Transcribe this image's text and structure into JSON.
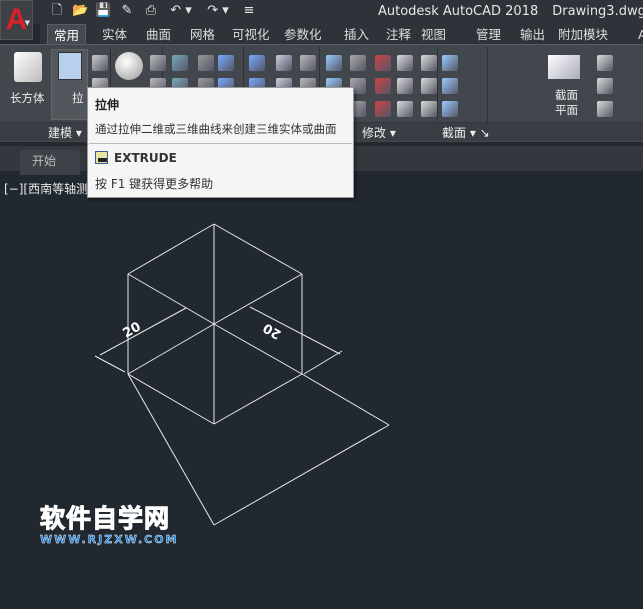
{
  "app": {
    "logo_letter": "A",
    "title": "Autodesk AutoCAD 2018",
    "document": "Drawing3.dwg"
  },
  "quick_access": [
    "new-icon",
    "open-icon",
    "save-icon",
    "saveas-icon",
    "plot-icon",
    "undo-icon",
    "redo-icon",
    "customize-icon"
  ],
  "tabs": [
    {
      "label": "常用",
      "active": true
    },
    {
      "label": "实体"
    },
    {
      "label": "曲面"
    },
    {
      "label": "网格"
    },
    {
      "label": "可视化"
    },
    {
      "label": "参数化"
    },
    {
      "label": "插入"
    },
    {
      "label": "注释"
    },
    {
      "label": "视图"
    },
    {
      "label": "管理"
    },
    {
      "label": "输出"
    },
    {
      "label": "附加模块"
    },
    {
      "label": "A"
    }
  ],
  "ribbon": {
    "box_label": "长方体",
    "extrude_label": "拉",
    "section_plane_label1": "截面",
    "section_plane_label2": "平面",
    "panels": [
      {
        "label": "建模"
      },
      {
        "label": "修改"
      },
      {
        "label": "截面"
      }
    ]
  },
  "tooltip": {
    "title": "拉伸",
    "description": "通过拉伸二维或三维曲线来创建三维实体或曲面",
    "command": "EXTRUDE",
    "help": "按 F1 键获得更多帮助"
  },
  "file_tabs": [
    {
      "label": "开始"
    }
  ],
  "viewport": {
    "label": "[−][西南等轴测"
  },
  "drawing": {
    "dimensions": [
      "20",
      "20"
    ],
    "line_color": "#e8e8e8",
    "background": "#212830"
  },
  "watermark": {
    "cn": "软件自学网",
    "en": "WWW.RJZXW.COM",
    "color": "#1a7ed6"
  },
  "colors": {
    "accent_red": "#d8222a",
    "ribbon": "#42464d",
    "titlebar": "#2f3339"
  }
}
